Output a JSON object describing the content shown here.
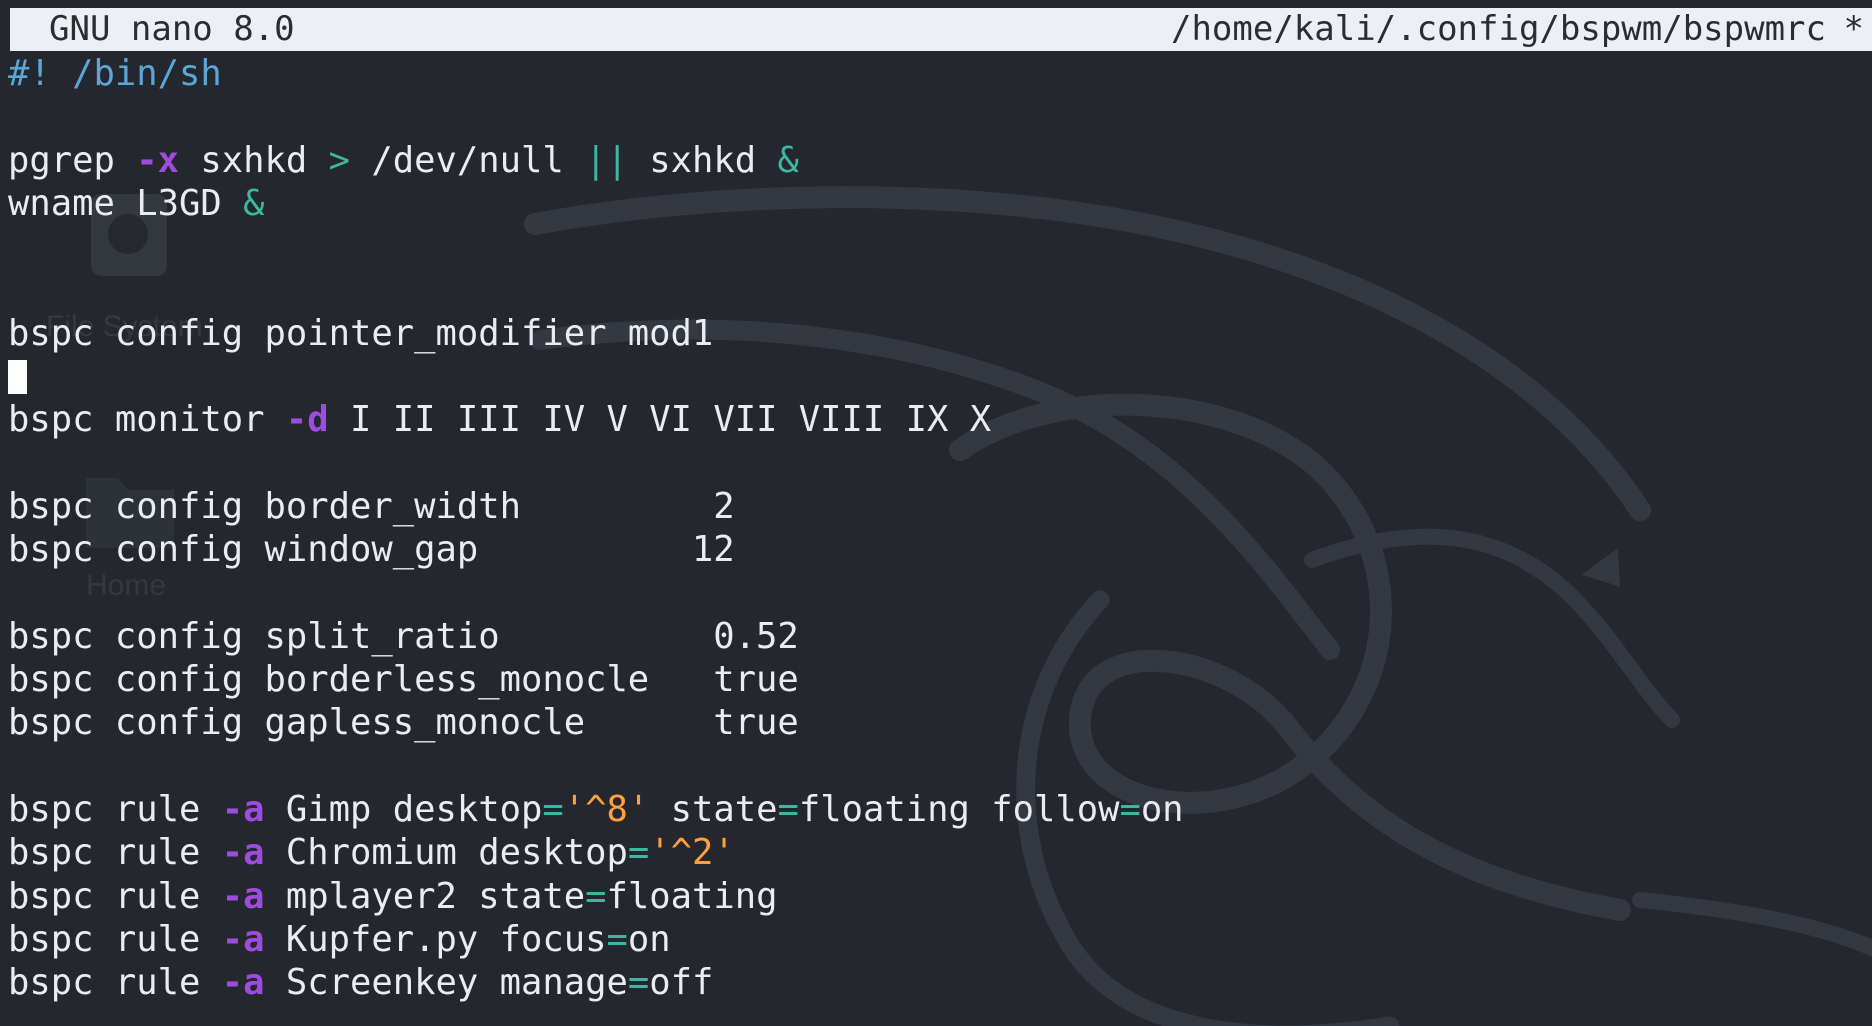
{
  "titlebar": {
    "app_name": "GNU nano 8.0",
    "file_path": "/home/kali/.config/bspwm/bspwmrc",
    "modified_marker": "*"
  },
  "desktop_icons": {
    "file_system_label": "File System",
    "home_label": "Home"
  },
  "editor": {
    "lines": [
      [
        {
          "text": "#! /bin/sh",
          "type": "comment"
        }
      ],
      [],
      [
        {
          "text": "pgrep ",
          "type": "plain"
        },
        {
          "text": "-x",
          "type": "flag"
        },
        {
          "text": " sxhkd ",
          "type": "plain"
        },
        {
          "text": ">",
          "type": "op"
        },
        {
          "text": " /dev/null ",
          "type": "plain"
        },
        {
          "text": "||",
          "type": "op"
        },
        {
          "text": " sxhkd ",
          "type": "plain"
        },
        {
          "text": "&",
          "type": "op"
        }
      ],
      [
        {
          "text": "wname L3GD ",
          "type": "plain"
        },
        {
          "text": "&",
          "type": "op"
        }
      ],
      [],
      [],
      [
        {
          "text": "bspc config pointer_modifier mod1",
          "type": "plain"
        }
      ],
      [],
      [
        {
          "text": "bspc monitor ",
          "type": "plain"
        },
        {
          "text": "-d",
          "type": "flag"
        },
        {
          "text": " I II III IV V VI VII VIII IX X",
          "type": "plain"
        }
      ],
      [],
      [
        {
          "text": "bspc config border_width         2",
          "type": "plain"
        }
      ],
      [
        {
          "text": "bspc config window_gap          12",
          "type": "plain"
        }
      ],
      [],
      [
        {
          "text": "bspc config split_ratio          0.52",
          "type": "plain"
        }
      ],
      [
        {
          "text": "bspc config borderless_monocle   true",
          "type": "plain"
        }
      ],
      [
        {
          "text": "bspc config gapless_monocle      true",
          "type": "plain"
        }
      ],
      [],
      [
        {
          "text": "bspc rule ",
          "type": "plain"
        },
        {
          "text": "-a",
          "type": "flag"
        },
        {
          "text": " Gimp desktop",
          "type": "plain"
        },
        {
          "text": "=",
          "type": "op"
        },
        {
          "text": "'^8'",
          "type": "string"
        },
        {
          "text": " state",
          "type": "plain"
        },
        {
          "text": "=",
          "type": "op"
        },
        {
          "text": "floating follow",
          "type": "plain"
        },
        {
          "text": "=",
          "type": "op"
        },
        {
          "text": "on",
          "type": "plain"
        }
      ],
      [
        {
          "text": "bspc rule ",
          "type": "plain"
        },
        {
          "text": "-a",
          "type": "flag"
        },
        {
          "text": " Chromium desktop",
          "type": "plain"
        },
        {
          "text": "=",
          "type": "op"
        },
        {
          "text": "'^2'",
          "type": "string"
        }
      ],
      [
        {
          "text": "bspc rule ",
          "type": "plain"
        },
        {
          "text": "-a",
          "type": "flag"
        },
        {
          "text": " mplayer2 state",
          "type": "plain"
        },
        {
          "text": "=",
          "type": "op"
        },
        {
          "text": "floating",
          "type": "plain"
        }
      ],
      [
        {
          "text": "bspc rule ",
          "type": "plain"
        },
        {
          "text": "-a",
          "type": "flag"
        },
        {
          "text": " Kupfer.py focus",
          "type": "plain"
        },
        {
          "text": "=",
          "type": "op"
        },
        {
          "text": "on",
          "type": "plain"
        }
      ],
      [
        {
          "text": "bspc rule ",
          "type": "plain"
        },
        {
          "text": "-a",
          "type": "flag"
        },
        {
          "text": " Screenkey manage",
          "type": "plain"
        },
        {
          "text": "=",
          "type": "op"
        },
        {
          "text": "off",
          "type": "plain"
        }
      ]
    ]
  },
  "colors": {
    "background": "#24272d",
    "titlebar": "#eceff3",
    "comment": "#5aa6d6",
    "flag": "#9f4be0",
    "operator": "#3fb6a1",
    "string": "#ff9f3d",
    "text": "#e9edf2"
  },
  "icons": {
    "desktop_file_system": "disk-drive-icon",
    "desktop_home": "folder-icon",
    "wallpaper": "kali-dragon-icon"
  }
}
